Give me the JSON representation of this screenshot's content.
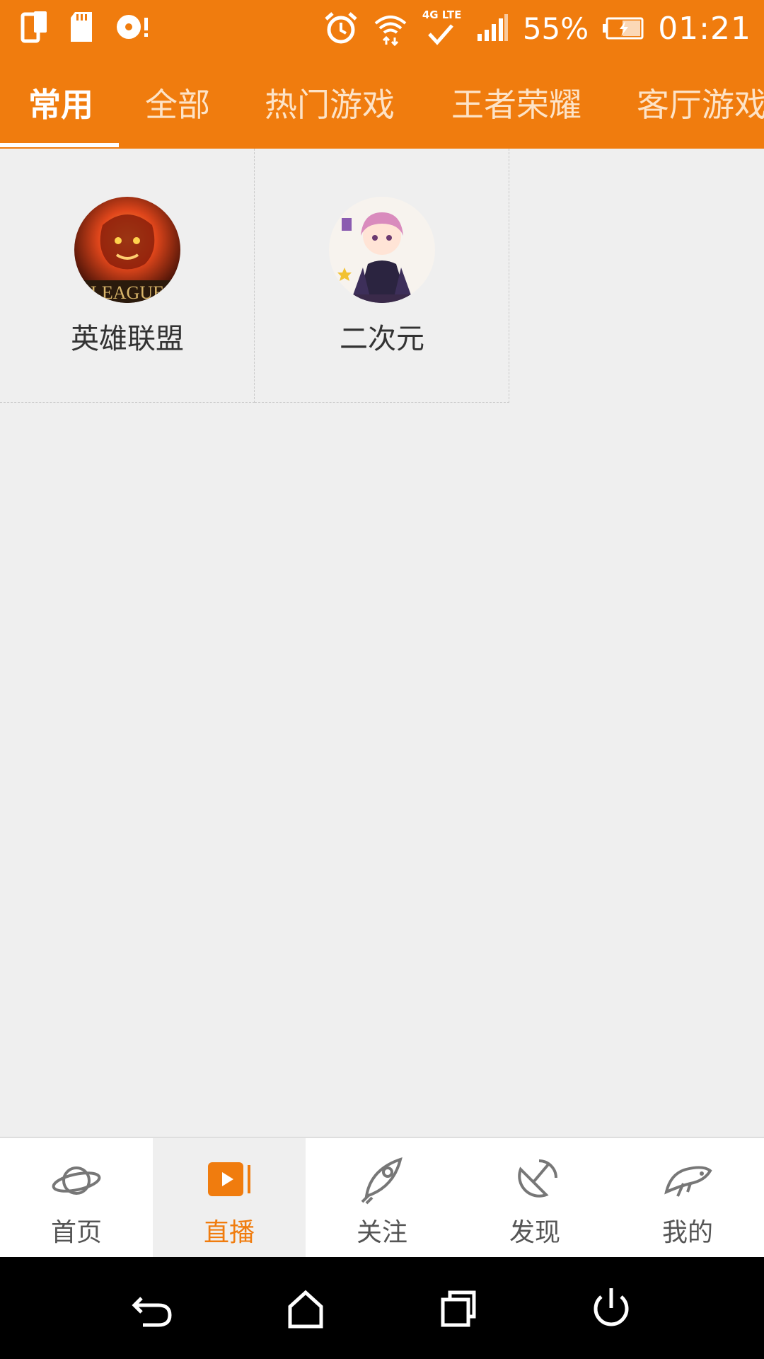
{
  "status_bar": {
    "battery": "55%",
    "time": "01:21",
    "network": "4G LTE",
    "icons": [
      "phone-screen-icon",
      "sd-card-icon",
      "disc-alert-icon",
      "alarm-icon",
      "wifi-icon",
      "signal-icon",
      "battery-charging-icon"
    ]
  },
  "tabs": [
    {
      "label": "常用",
      "active": true
    },
    {
      "label": "全部",
      "active": false
    },
    {
      "label": "热门游戏",
      "active": false
    },
    {
      "label": "王者荣耀",
      "active": false
    },
    {
      "label": "客厅游戏",
      "active": false
    }
  ],
  "categories": [
    {
      "label": "英雄联盟",
      "image": "league-of-legends-avatar"
    },
    {
      "label": "二次元",
      "image": "anime-girl-avatar"
    }
  ],
  "avatar_badge_text": "LEAGUE",
  "bottom_nav": [
    {
      "label": "首页",
      "icon": "planet-icon",
      "active": false
    },
    {
      "label": "直播",
      "icon": "live-play-icon",
      "active": true
    },
    {
      "label": "关注",
      "icon": "rocket-icon",
      "active": false
    },
    {
      "label": "发现",
      "icon": "satellite-dish-icon",
      "active": false
    },
    {
      "label": "我的",
      "icon": "fish-icon",
      "active": false
    }
  ],
  "system_nav": [
    "back-icon",
    "home-icon",
    "recents-icon",
    "power-icon"
  ],
  "colors": {
    "brand": "#f07c0e",
    "tab_inactive": "#fde3c7",
    "background": "#efefef",
    "label": "#333333",
    "nav_label": "#555555"
  }
}
